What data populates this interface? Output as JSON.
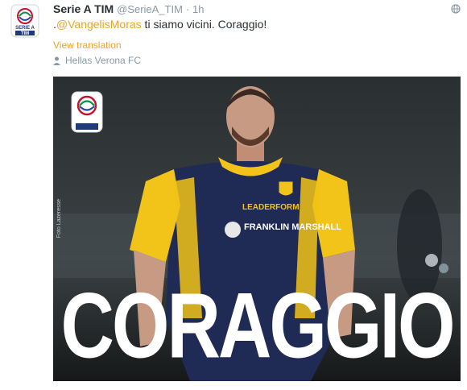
{
  "tweet": {
    "display_name": "Serie A TIM",
    "handle": "@SerieA_TIM",
    "separator": "·",
    "time": "1h",
    "text_prefix": ".",
    "mention": "@VangelisMoras",
    "text_rest": " ti siamo vicini. Coraggio!",
    "translate_label": "View translation",
    "location": "Hellas Verona FC"
  },
  "photo": {
    "headline": "CORAGGIO",
    "credit": "Foto Lazeresse",
    "jersey_sponsor_top": "LEADERFORM",
    "jersey_sponsor": "FRANKLIN MARSHALL"
  },
  "logo": {
    "line1": "SERIE A",
    "line2": "TIM"
  },
  "colors": {
    "accent": "#e8a42b",
    "muted": "#8899a6",
    "jersey_yellow": "#f2c318",
    "jersey_navy": "#1f2a55"
  },
  "icons": {
    "globe": "globe-icon",
    "location": "location-pin-icon"
  }
}
